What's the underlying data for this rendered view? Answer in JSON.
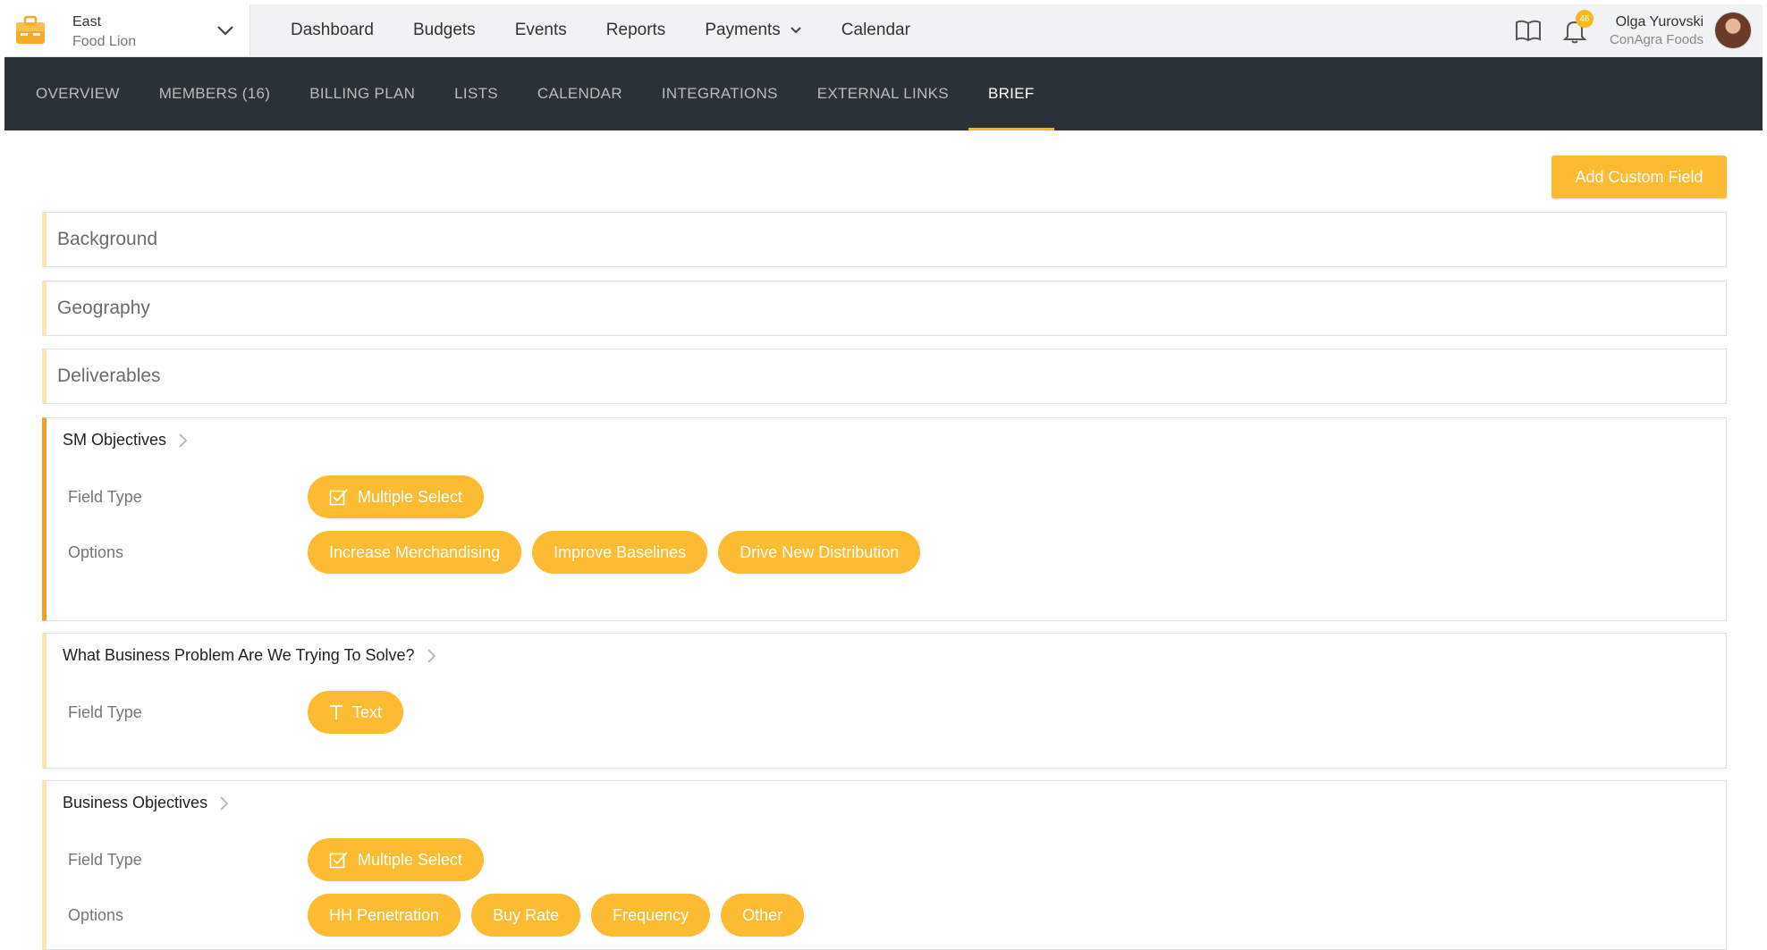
{
  "org": {
    "line1": "East",
    "line2": "Food Lion"
  },
  "main_nav": [
    {
      "label": "Dashboard"
    },
    {
      "label": "Budgets"
    },
    {
      "label": "Events"
    },
    {
      "label": "Reports"
    },
    {
      "label": "Payments"
    },
    {
      "label": "Calendar"
    }
  ],
  "notifications": {
    "count": "46"
  },
  "user": {
    "name": "Olga Yurovski",
    "company": "ConAgra Foods"
  },
  "sub_nav": [
    {
      "label": "OVERVIEW"
    },
    {
      "label": "MEMBERS (16)"
    },
    {
      "label": "BILLING PLAN"
    },
    {
      "label": "LISTS"
    },
    {
      "label": "CALENDAR"
    },
    {
      "label": "INTEGRATIONS"
    },
    {
      "label": "EXTERNAL LINKS"
    },
    {
      "label": "BRIEF",
      "active": true
    }
  ],
  "add_custom_field_label": "Add Custom Field",
  "collapsed_fields": [
    "Background",
    "Geography",
    "Deliverables"
  ],
  "row_labels": {
    "field_type": "Field Type",
    "options": "Options"
  },
  "fields": [
    {
      "title": "SM Objectives",
      "field_type": "Multiple Select",
      "options": [
        "Increase Merchandising",
        "Improve Baselines",
        "Drive New Distribution"
      ]
    },
    {
      "title": "What Business Problem Are We Trying To Solve?",
      "field_type": "Text",
      "options": []
    },
    {
      "title": "Business Objectives",
      "field_type": "Multiple Select",
      "options": [
        "HH Penetration",
        "Buy Rate",
        "Frequency",
        "Other"
      ]
    }
  ],
  "colors": {
    "accent": "#fbbb33",
    "active_border": "#f59a23",
    "subnav_bg": "#2a3137"
  }
}
